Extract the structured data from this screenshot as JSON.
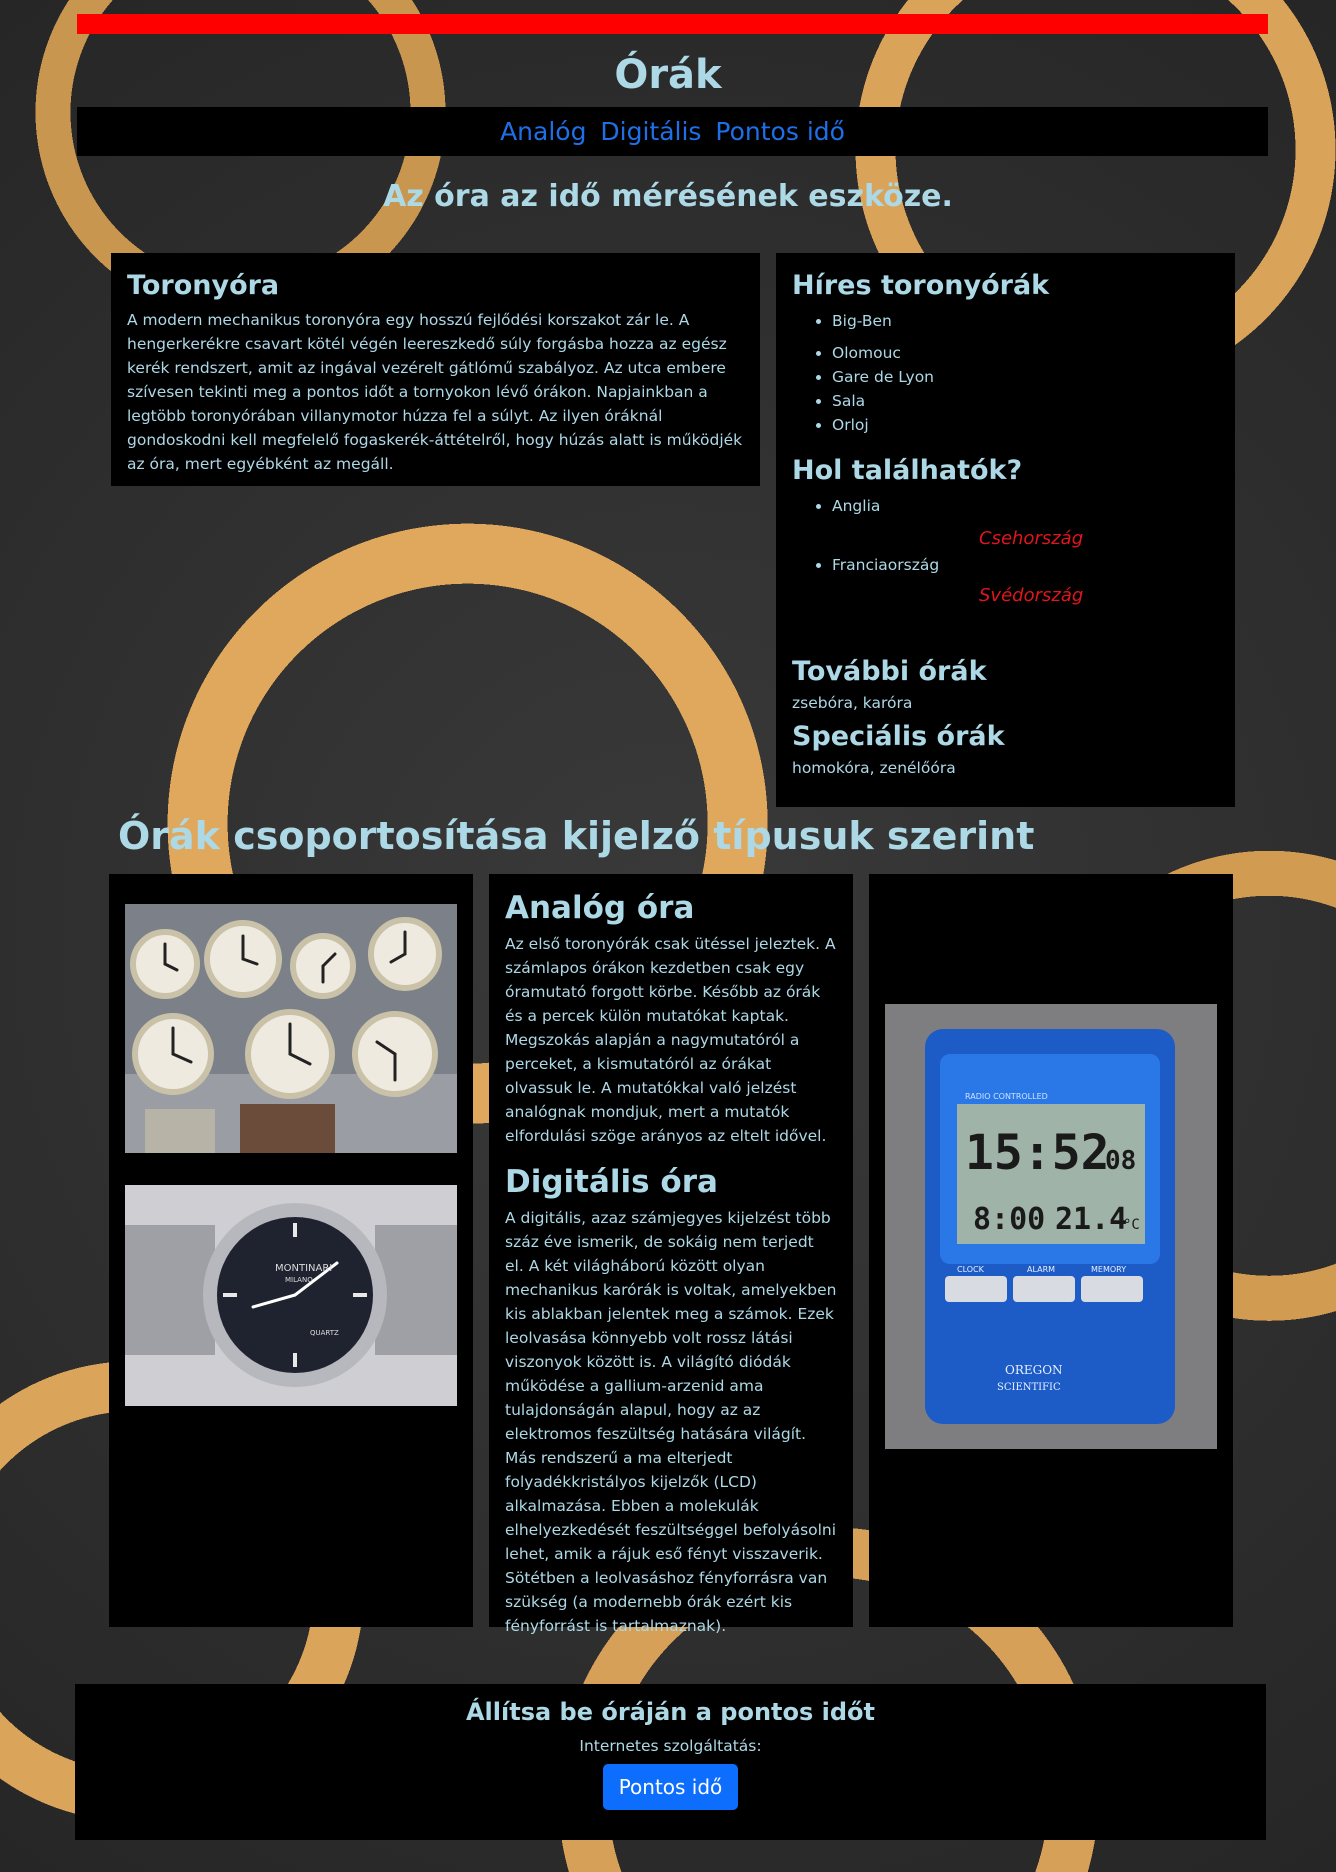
{
  "header": {
    "title": "Órák",
    "nav": [
      {
        "label": "Analóg"
      },
      {
        "label": "Digitális"
      },
      {
        "label": "Pontos idő"
      }
    ],
    "tagline": "Az óra az idő mérésének eszköze."
  },
  "tower": {
    "heading": "Toronyóra",
    "text": "A modern mechanikus toronyóra egy hosszú fejlődési korszakot zár le. A hengerkerékre csavart kötél végén leereszkedő súly forgásba hozza az egész kerék rendszert, amit az ingával vezérelt gátlómű szabályoz. Az utca embere szívesen tekinti meg a pontos időt a tornyokon lévő órákon. Napjainkban a legtöbb toronyórában villanymotor húzza fel a súlyt. Az ilyen óráknál gondoskodni kell megfelelő fogaskerék-áttételről, hogy húzás alatt is működjék az óra, mert egyébként az megáll."
  },
  "sidebar": {
    "famous_heading": "Híres toronyórák",
    "famous": [
      "Big-Ben",
      "Olomouc",
      "Gare de Lyon",
      "Sala",
      "Orloj"
    ],
    "where_heading": "Hol találhatók?",
    "where": [
      "Anglia",
      "Csehország",
      "Franciaország",
      "Svédország"
    ],
    "more_heading": "További órák",
    "more_text": "zsebóra, karóra",
    "special_heading": "Speciális órák",
    "special_text": "homokóra, zenélőóra"
  },
  "group": {
    "title": "Órák csoportosítása kijelző típusuk szerint",
    "analog_heading": "Analóg óra",
    "analog_text": "Az első toronyórák csak ütéssel jeleztek. A számlapos órákon kezdetben csak egy óramutató forgott körbe. Később az órák és a percek külön mutatókat kaptak. Megszokás alapján a nagymutatóról a perceket, a kismutatóról az órákat olvassuk le. A mutatókkal való jelzést analógnak mondjuk, mert a mutatók elfordulási szöge arányos az eltelt idővel.",
    "digital_heading": "Digitális óra",
    "digital_text": "A digitális, azaz számjegyes kijelzést több száz éve ismerik, de sokáig nem terjedt el. A két világháború között olyan mechanikus karórák is voltak, amelyekben kis ablakban jelentek meg a számok. Ezek leolvasása könnyebb volt rossz látási viszonyok között is. A világító diódák működése a gallium-arzenid ama tulajdonságán alapul, hogy az az elektromos feszültség hatására világít. Más rendszerű a ma elterjedt folyadékkristályos kijelzők (LCD) alkalmazása. Ebben a molekulák elhelyezkedését feszültséggel befolyásolni lehet, amik a rájuk eső fényt visszaverik. Sötétben a leolvasáshoz fényforrásra van szükség (a modernebb órák ezért kis fényforrást is tartalmaznak)."
  },
  "images": {
    "watch": {
      "brand": "MONTINARI",
      "sub": "MILANO",
      "quartz": "QUARTZ"
    },
    "digital_clock": {
      "band": "RADIO CONTROLLED",
      "time": "15:52",
      "sec": "08",
      "alarm": "8:00",
      "temp": "21.4",
      "unit": "°C",
      "buttons": [
        "CLOCK",
        "ALARM",
        "MEMORY"
      ],
      "brand1": "OREGON",
      "brand2": "SCIENTIFIC"
    }
  },
  "cta": {
    "title": "Állítsa be óráján a pontos időt",
    "subtitle": "Internetes szolgáltatás:",
    "button": "Pontos idő"
  },
  "colors": {
    "accent_red": "#ff0000",
    "heading_text": "#add8e6",
    "link_blue": "#1e6fe8",
    "button_blue": "#0d6efd",
    "panel_bg": "#000000"
  }
}
